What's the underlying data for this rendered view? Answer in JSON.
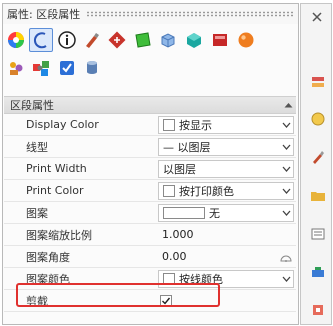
{
  "panel": {
    "title": "属性: 区段属性"
  },
  "toolbar": {
    "icons": [
      "color-wheel-icon",
      "curve-icon",
      "info-icon",
      "brush-icon",
      "transform-icon",
      "green-surface-icon",
      "blue-box-icon",
      "teal-cube-icon",
      "red-box-icon",
      "orange-sphere-icon",
      "pets-icon",
      "gear-tiles-icon",
      "check-shield-icon",
      "cylinder-icon"
    ],
    "active_icon": "curve-icon"
  },
  "section": {
    "label": "区段属性"
  },
  "rows": {
    "display_color": {
      "label": "Display Color",
      "value": "按显示"
    },
    "linetype": {
      "label": "线型",
      "value": "— 以图层"
    },
    "print_width": {
      "label": "Print Width",
      "value": "以图层"
    },
    "print_color": {
      "label": "Print Color",
      "value": "按打印颜色"
    },
    "hatch": {
      "label": "图案",
      "value": "无"
    },
    "hatch_scale": {
      "label": "图案缩放比例",
      "value": "1.000"
    },
    "hatch_angle": {
      "label": "图案角度",
      "value": "0.00"
    },
    "hatch_color": {
      "label": "图案颜色",
      "value": "按线颜色"
    },
    "clip": {
      "label": "剪截",
      "checked": true
    }
  },
  "colors": {
    "highlight": "#e0312f",
    "active": "#5c8ed8"
  }
}
